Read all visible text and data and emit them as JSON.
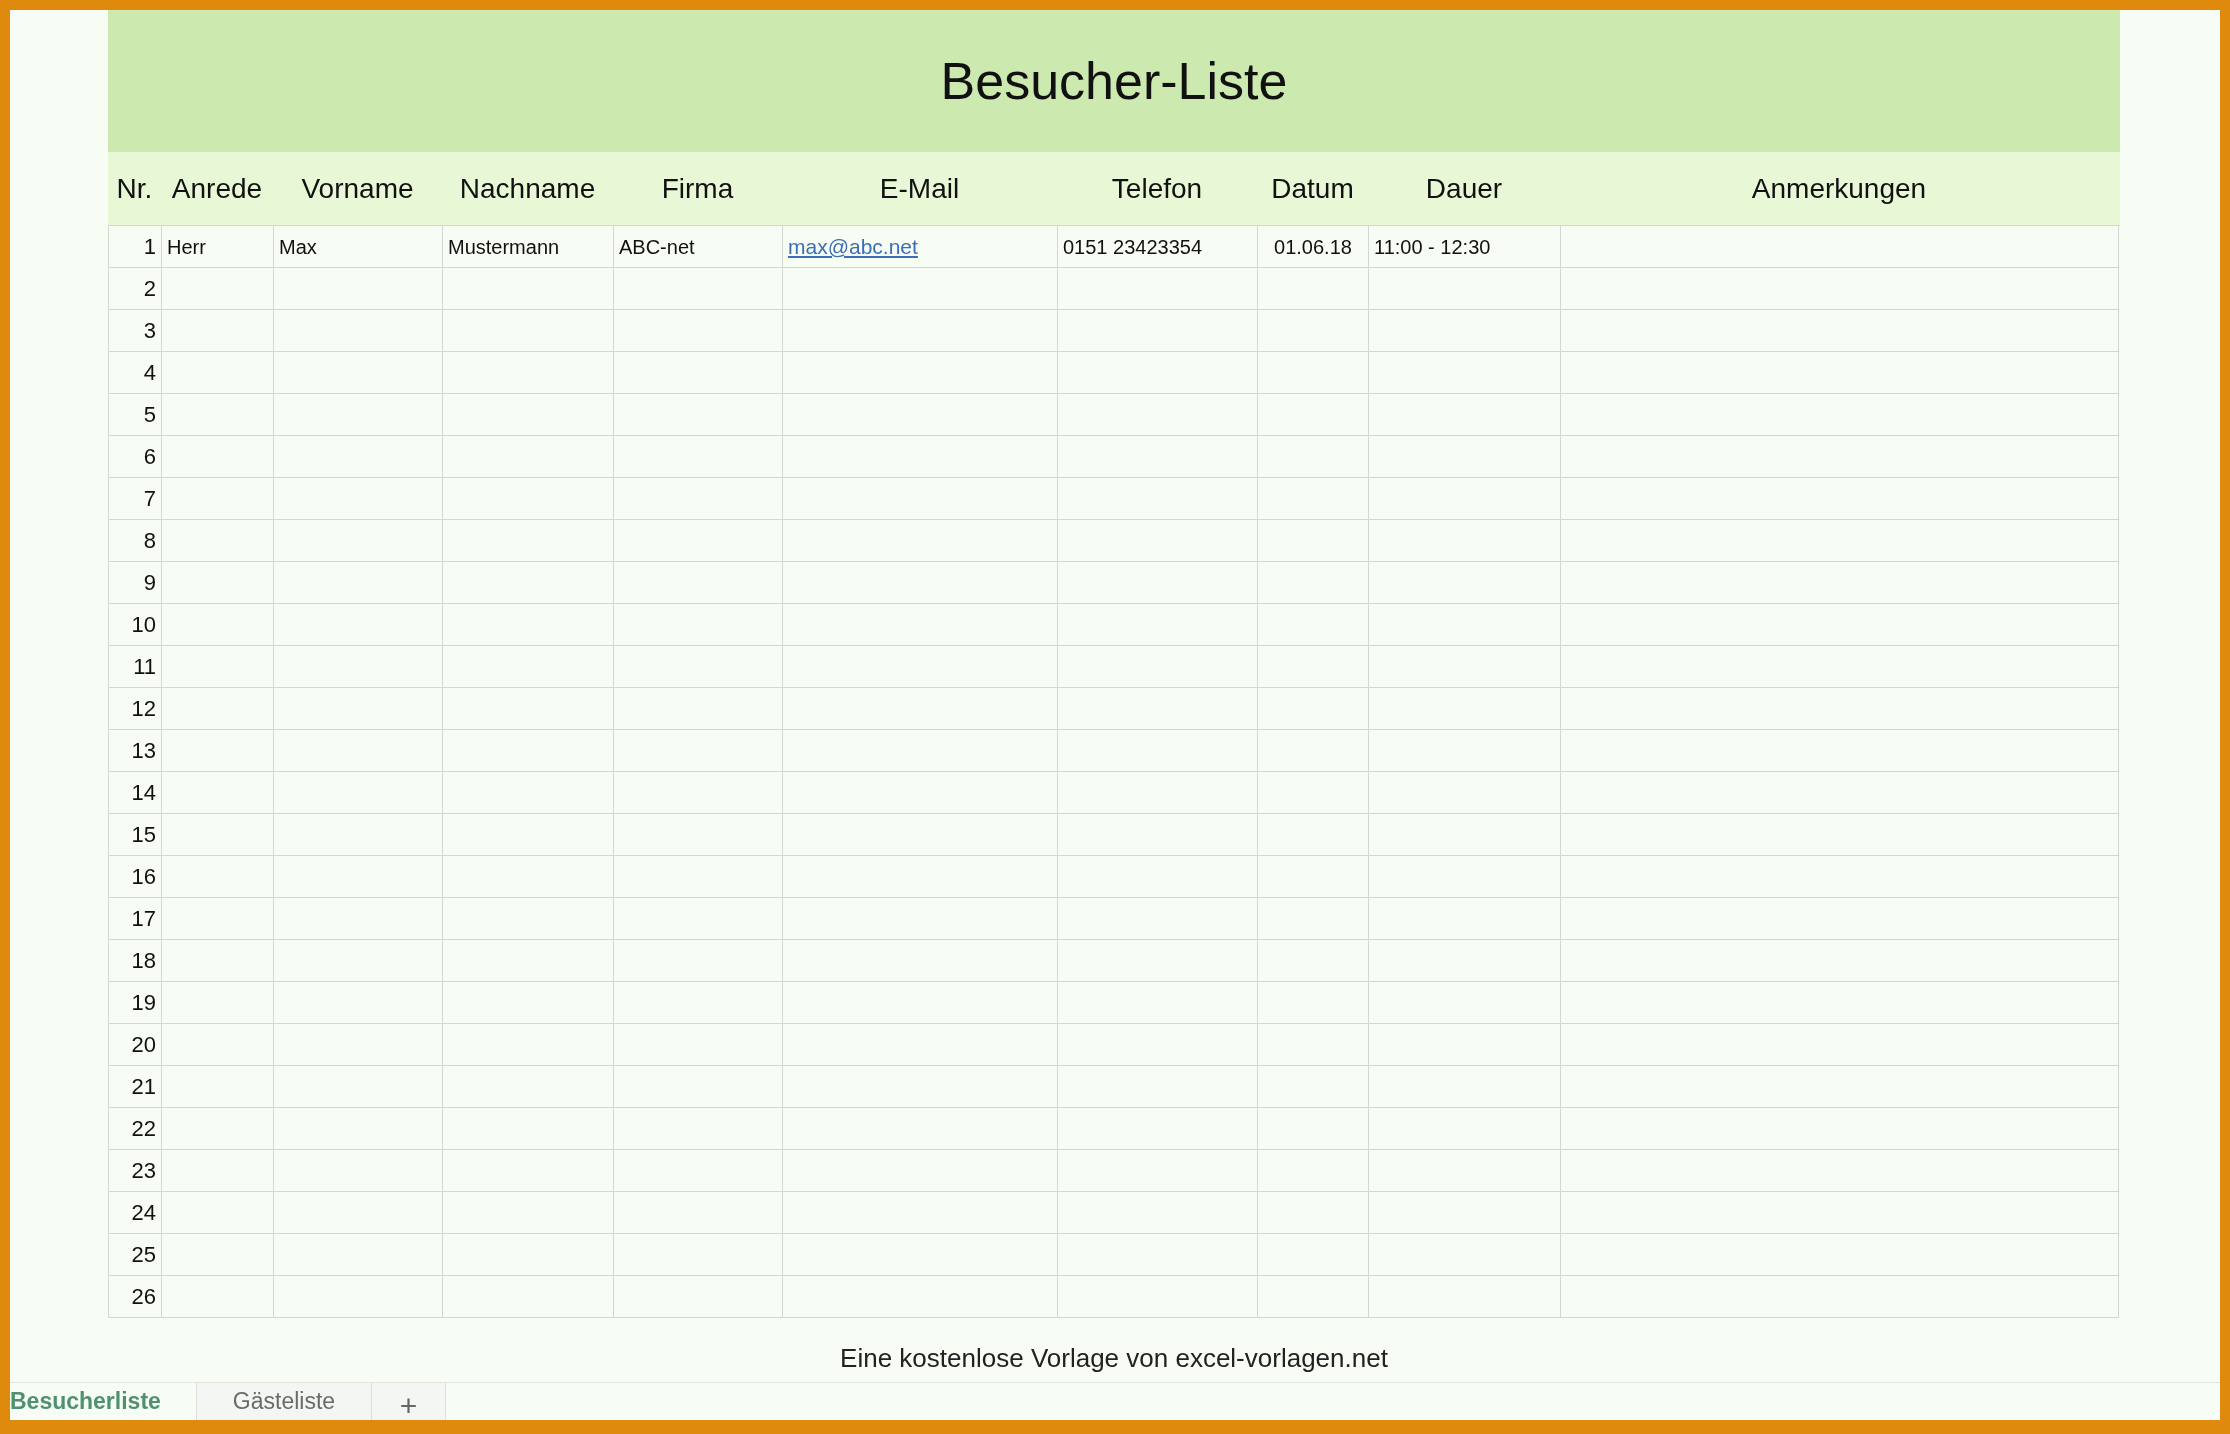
{
  "title": "Besucher-Liste",
  "columns": [
    {
      "label": "Nr.",
      "kind": "number"
    },
    {
      "label": "Anrede",
      "kind": "text"
    },
    {
      "label": "Vorname",
      "kind": "text"
    },
    {
      "label": "Nachname",
      "kind": "text"
    },
    {
      "label": "Firma",
      "kind": "text"
    },
    {
      "label": "E-Mail",
      "kind": "link"
    },
    {
      "label": "Telefon",
      "kind": "text"
    },
    {
      "label": "Datum",
      "kind": "date"
    },
    {
      "label": "Dauer",
      "kind": "text"
    },
    {
      "label": "Anmerkungen",
      "kind": "text"
    }
  ],
  "rows": [
    [
      "1",
      "Herr",
      "Max",
      "Mustermann",
      "ABC-net",
      "max@abc.net",
      "0151 23423354",
      "01.06.18",
      "11:00 - 12:30",
      ""
    ],
    [
      "2"
    ],
    [
      "3"
    ],
    [
      "4"
    ],
    [
      "5"
    ],
    [
      "6"
    ],
    [
      "7"
    ],
    [
      "8"
    ],
    [
      "9"
    ],
    [
      "10"
    ],
    [
      "11"
    ],
    [
      "12"
    ],
    [
      "13"
    ],
    [
      "14"
    ],
    [
      "15"
    ],
    [
      "16"
    ],
    [
      "17"
    ],
    [
      "18"
    ],
    [
      "19"
    ],
    [
      "20"
    ],
    [
      "21"
    ],
    [
      "22"
    ],
    [
      "23"
    ],
    [
      "24"
    ],
    [
      "25"
    ],
    [
      "26"
    ]
  ],
  "footer": "Eine kostenlose Vorlage von excel-vorlagen.net",
  "sheet_tabs": [
    {
      "label": "Besucherliste",
      "selected": true
    },
    {
      "label": "Gästeliste",
      "selected": false
    }
  ],
  "add_sheet": "+"
}
